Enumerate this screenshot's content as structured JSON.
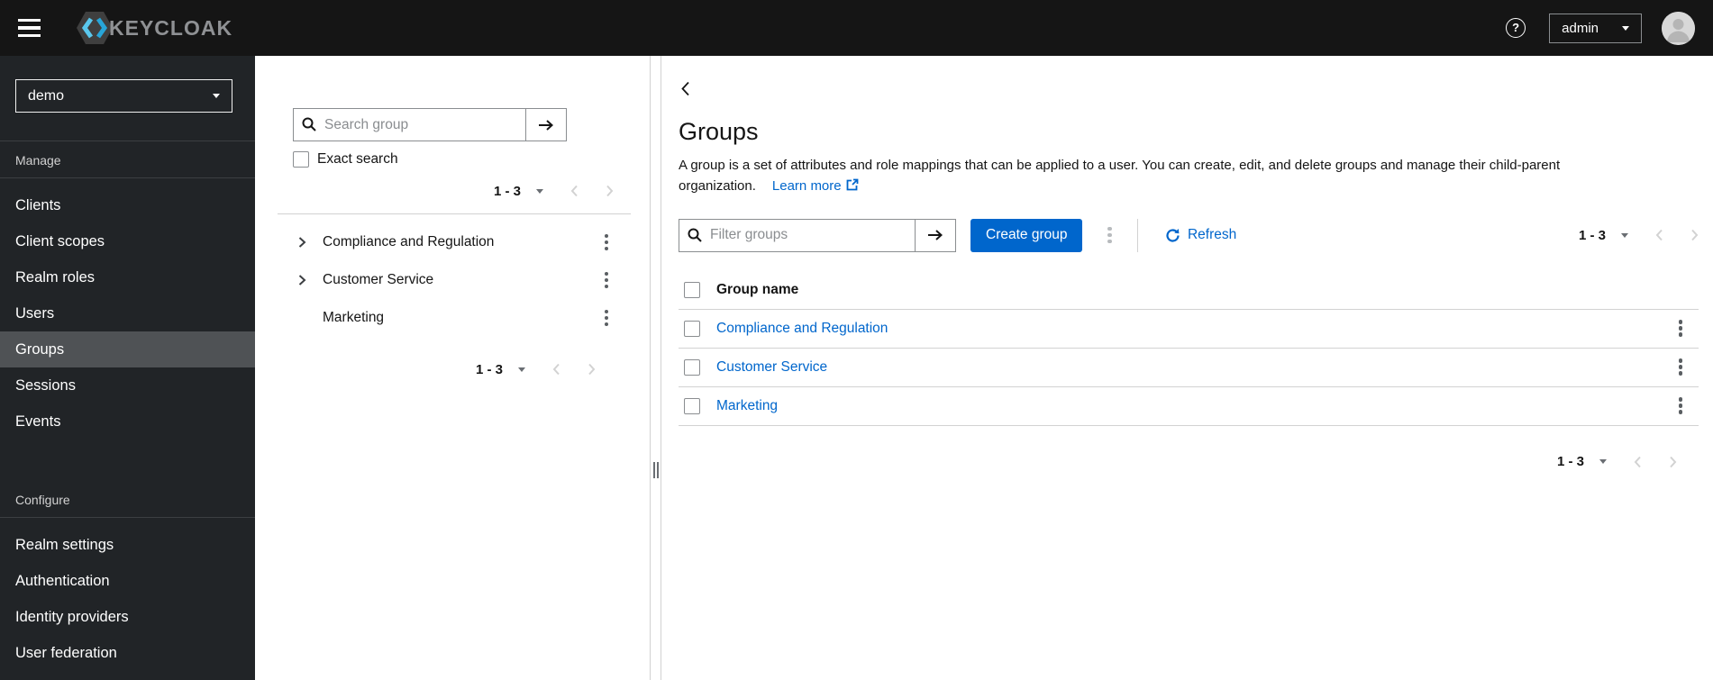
{
  "topbar": {
    "brand": "KEYCLOAK",
    "username": "admin"
  },
  "sidebar": {
    "realm": "demo",
    "manage": {
      "label": "Manage",
      "items": [
        "Clients",
        "Client scopes",
        "Realm roles",
        "Users",
        "Groups",
        "Sessions",
        "Events"
      ]
    },
    "configure": {
      "label": "Configure",
      "items": [
        "Realm settings",
        "Authentication",
        "Identity providers",
        "User federation"
      ]
    },
    "active_item": "Groups"
  },
  "tree_panel": {
    "search_placeholder": "Search group",
    "exact_search_label": "Exact search",
    "pagination_top": "1 - 3",
    "pagination_bottom": "1 - 3",
    "groups": [
      {
        "name": "Compliance and Regulation",
        "expandable": true
      },
      {
        "name": "Customer Service",
        "expandable": true
      },
      {
        "name": "Marketing",
        "expandable": false
      }
    ]
  },
  "main": {
    "title": "Groups",
    "description": "A group is a set of attributes and role mappings that can be applied to a user. You can create, edit, and delete groups and manage their child-parent organization.",
    "learn_more_label": "Learn more",
    "toolbar": {
      "filter_placeholder": "Filter groups",
      "create_button_label": "Create group",
      "refresh_label": "Refresh",
      "pagination": "1 - 3"
    },
    "table": {
      "header": "Group name",
      "rows": [
        "Compliance and Regulation",
        "Customer Service",
        "Marketing"
      ]
    },
    "pagination_bottom": "1 - 3"
  },
  "colors": {
    "primary": "#0066cc",
    "link": "#0066cc",
    "topbar_bg": "#151515",
    "sidebar_bg": "#212427",
    "sidebar_active_bg": "#4f5255",
    "border": "#d2d2d2"
  }
}
